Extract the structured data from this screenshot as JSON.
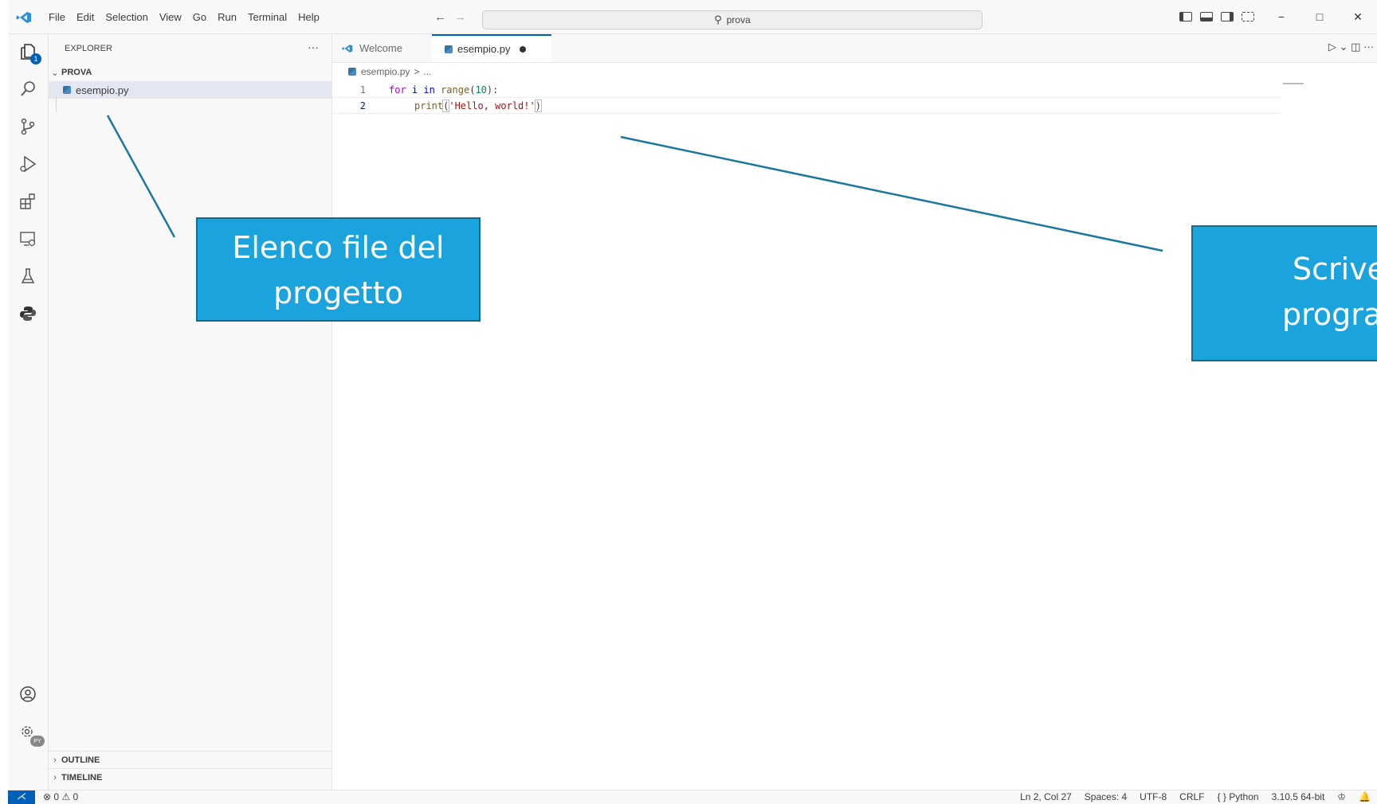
{
  "menu": [
    "File",
    "Edit",
    "Selection",
    "View",
    "Go",
    "Run",
    "Terminal",
    "Help"
  ],
  "search": {
    "text": "prova"
  },
  "nav": {
    "back": "←",
    "forward": "→"
  },
  "window": {
    "minimize": "−",
    "maximize": "□",
    "close": "✕"
  },
  "activity": {
    "explorer_badge": "1",
    "settings_badge": "PY"
  },
  "sidebar": {
    "title": "EXPLORER",
    "more": "···",
    "folder": "PROVA",
    "files": [
      "esempio.py"
    ],
    "outline": "OUTLINE",
    "timeline": "TIMELINE"
  },
  "tabs": [
    {
      "label": "Welcome"
    },
    {
      "label": "esempio.py",
      "dirty": true
    }
  ],
  "tab_actions": "▷ ⌄  ◫  ···",
  "breadcrumb": {
    "file": "esempio.py",
    "sep": ">",
    "rest": "..."
  },
  "code": {
    "line_numbers": [
      "1",
      "2"
    ],
    "line1": {
      "kw": "for",
      "var1": "i",
      "in": "in",
      "fn": "range",
      "open": "(",
      "num": "10",
      "close": "):"
    },
    "line2": {
      "fn": "print",
      "open": "(",
      "str": "'Hello, world!'",
      "close": ")"
    }
  },
  "status": {
    "remote": "⋌",
    "problems": "⊗ 0 ⚠ 0",
    "position": "Ln 2, Col 27",
    "spaces": "Spaces: 4",
    "encoding": "UTF-8",
    "eol": "CRLF",
    "language": "{ } Python",
    "interpreter": "3.10.5 64-bit",
    "feedback": "♔",
    "bell": "🔔"
  },
  "callouts": {
    "left_line1": "Elenco file del",
    "left_line2": "progetto",
    "right_line1": "Scrive",
    "right_line2": "progra"
  },
  "colors": {
    "accent": "#005fb8",
    "callout": "#1aa3dc",
    "pointer": "#1a78a0"
  }
}
